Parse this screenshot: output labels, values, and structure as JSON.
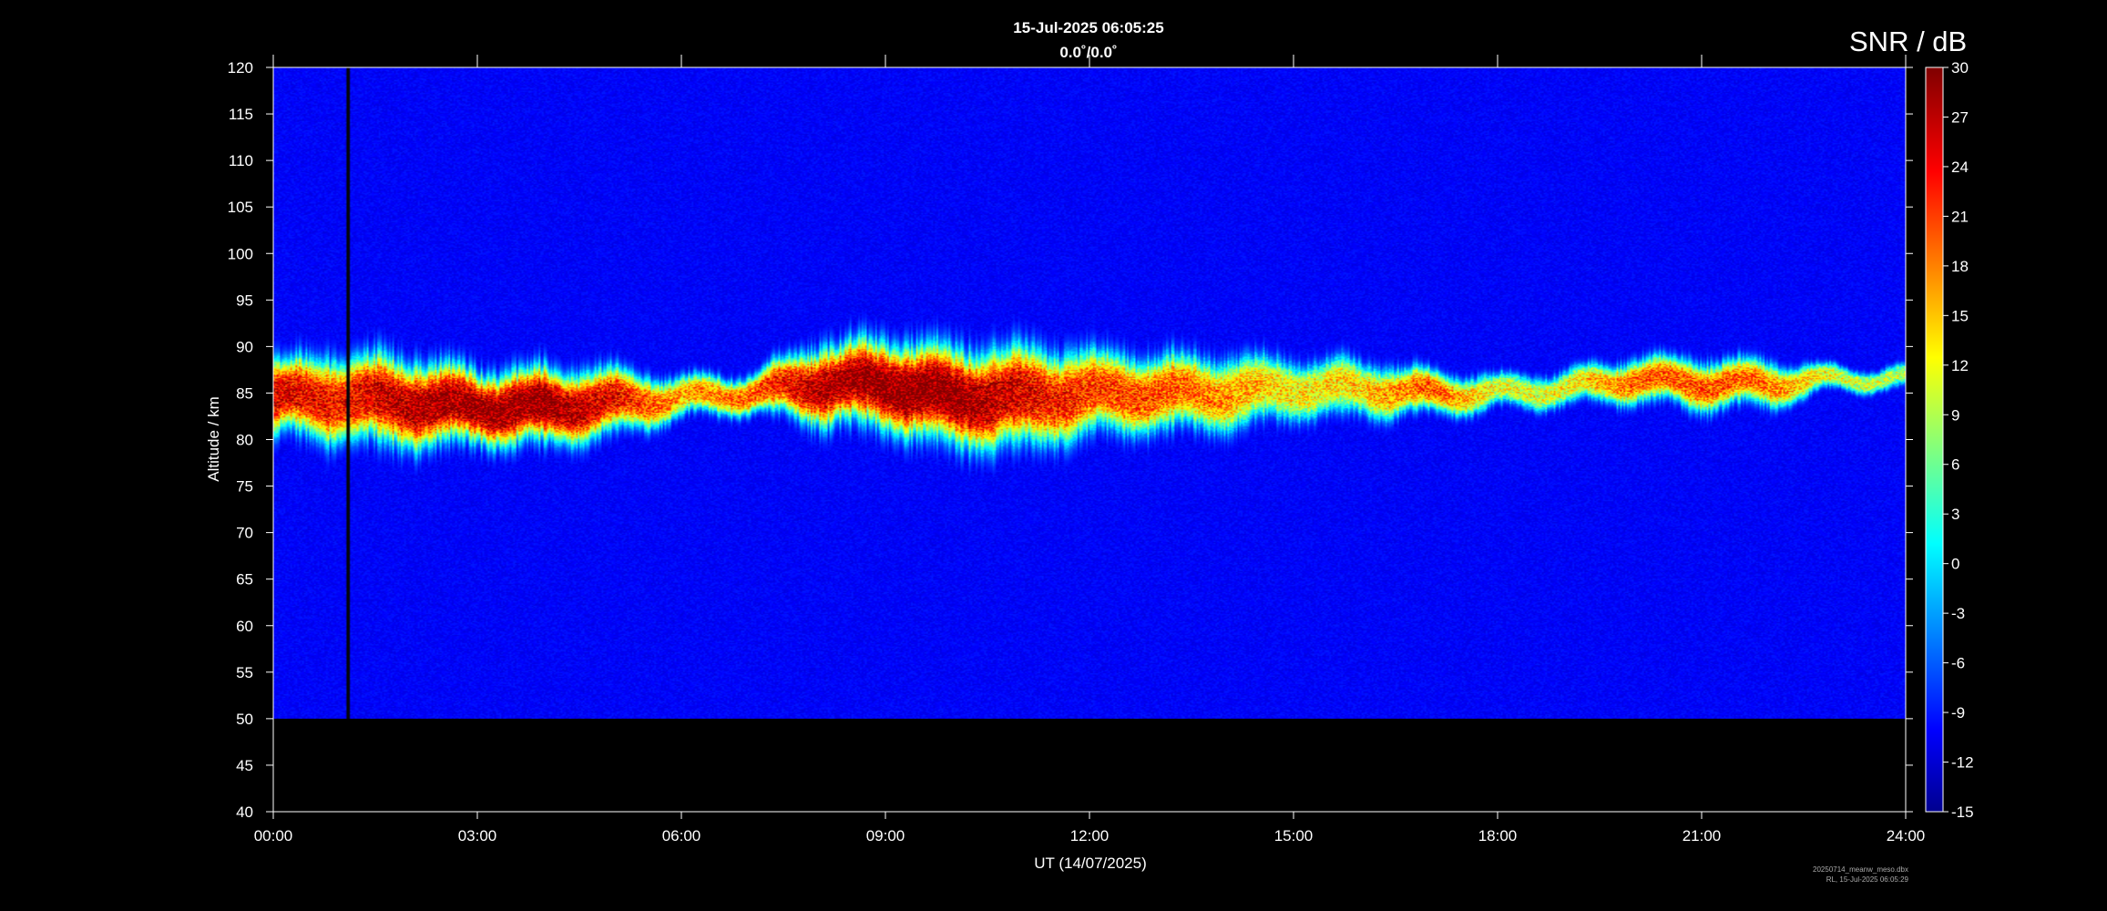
{
  "chart_data": {
    "type": "heatmap",
    "title": "15-Jul-2025 06:05:25",
    "subtitle": "0.0˚/0.0˚",
    "xlabel": "UT (14/07/2025)",
    "ylabel": "Altitude / km",
    "xlim": [
      "00:00",
      "24:00"
    ],
    "ylim": [
      40,
      120
    ],
    "x_ticks": [
      "00:00",
      "03:00",
      "06:00",
      "09:00",
      "12:00",
      "15:00",
      "18:00",
      "21:00",
      "24:00"
    ],
    "y_ticks": [
      40,
      45,
      50,
      55,
      60,
      65,
      70,
      75,
      80,
      85,
      90,
      95,
      100,
      105,
      110,
      115,
      120
    ],
    "data_altitude_range_km": [
      50,
      120
    ],
    "data_gap_hours": [
      1.07,
      1.12
    ],
    "colorbar": {
      "label": "SNR / dB",
      "range": [
        -15,
        30
      ],
      "ticks": [
        30,
        27,
        24,
        21,
        18,
        15,
        12,
        9,
        6,
        3,
        0,
        -3,
        -6,
        -9,
        -12,
        -15
      ],
      "colormap": "jet"
    },
    "layers_by_hour": {
      "hours": [
        0,
        1,
        2,
        3,
        4,
        5,
        6,
        7,
        8,
        9,
        10,
        11,
        12,
        13,
        14,
        15,
        16,
        17,
        18,
        19,
        20,
        21,
        22,
        23,
        24
      ],
      "center_km": [
        84.5,
        84.5,
        84,
        83.5,
        83.5,
        84,
        84.5,
        85,
        86,
        86,
        84.5,
        84.5,
        85,
        85,
        85,
        85.5,
        85.5,
        85,
        85,
        85.5,
        86.5,
        86,
        86,
        86.5,
        86.5
      ],
      "thickness_km": [
        6.5,
        8,
        8,
        6.5,
        7,
        6,
        3.5,
        3.5,
        7,
        8,
        9,
        9,
        7.5,
        7,
        6.5,
        5.5,
        5,
        4,
        3,
        3,
        4,
        4.5,
        4,
        2,
        2
      ],
      "peak_snr_db": [
        26,
        24,
        28,
        29,
        30,
        25,
        17,
        20,
        28,
        30,
        30,
        26,
        22,
        21,
        18,
        14,
        15,
        21,
        12,
        13,
        20,
        21,
        19,
        12,
        10
      ]
    },
    "background_snr_db": -9.5,
    "annotations": [
      "20250714_meanw_meso.dbx",
      "RL, 15-Jul-2025 06:05:29"
    ]
  }
}
